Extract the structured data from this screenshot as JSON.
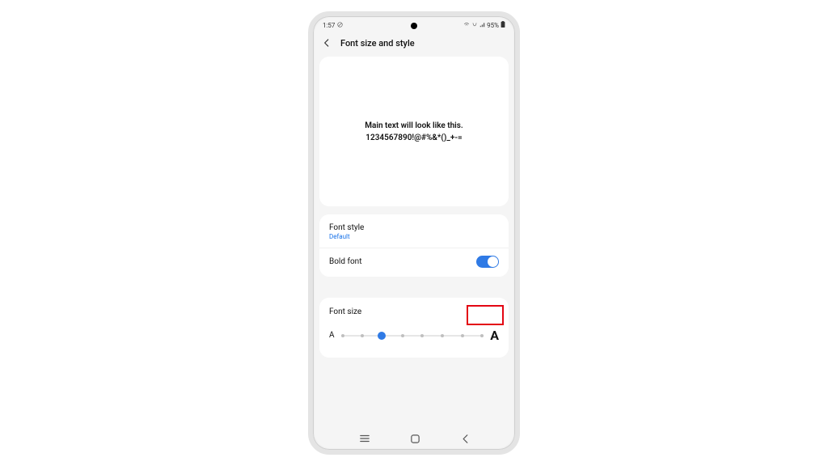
{
  "status_bar": {
    "time": "1:57",
    "battery_text": "95%"
  },
  "header": {
    "title": "Font size and style"
  },
  "preview": {
    "line1": "Main text will look like this.",
    "line2": "1234567890!@#%&*()_+-="
  },
  "settings": {
    "font_style": {
      "label": "Font style",
      "value": "Default"
    },
    "bold_font": {
      "label": "Bold font",
      "enabled": true
    }
  },
  "font_size": {
    "label": "Font size",
    "steps": 8,
    "current": 2,
    "small_glyph": "A",
    "large_glyph": "A"
  },
  "colors": {
    "accent": "#2f7ae5",
    "highlight": "#e30613",
    "link": "#1a73e8"
  }
}
